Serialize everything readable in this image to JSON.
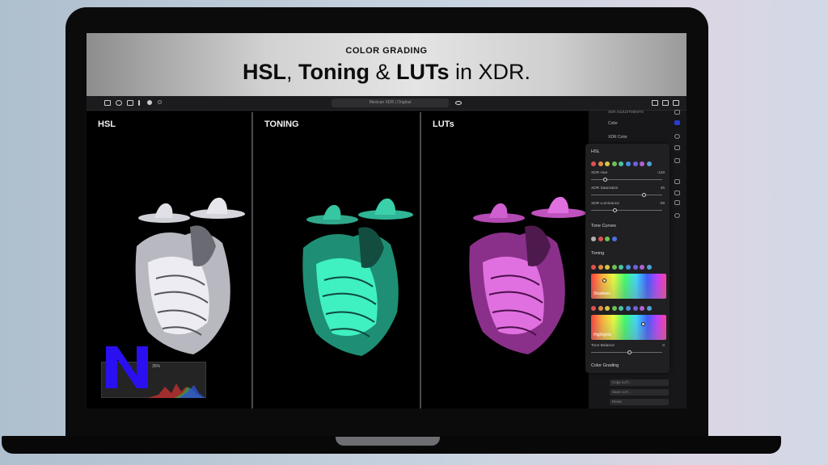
{
  "banner": {
    "kicker": "COLOR GRADING",
    "title_hsl": "HSL",
    "title_sep1": ", ",
    "title_toning": "Toning",
    "title_sep2": " & ",
    "title_luts": "LUTs",
    "title_tail": " in XDR."
  },
  "toolbar": {
    "document_title": "Mexican XDR | Original"
  },
  "panels": [
    {
      "label": "HSL",
      "tint": "#d8d8de"
    },
    {
      "label": "TONING",
      "tint": "#39e0b4"
    },
    {
      "label": "LUTs",
      "tint": "#d25ad2"
    }
  ],
  "histogram": {
    "value": "35%"
  },
  "sidebar": {
    "items": [
      {
        "label": "XDR ADJUSTMENTS"
      },
      {
        "label": "Color"
      },
      {
        "label": "XDR Color"
      }
    ],
    "fields": [
      {
        "label": "Copy LUT..."
      },
      {
        "label": "Save LUT..."
      },
      {
        "label": "Reset"
      }
    ]
  },
  "adjustments": {
    "hsl_heading": "HSL",
    "sliders": [
      {
        "label": "XDR Hue",
        "value": "-129",
        "fraction": 0.2
      },
      {
        "label": "XDR Saturation",
        "value": "45",
        "fraction": 0.75
      },
      {
        "label": "XDR Luminance",
        "value": "-39",
        "fraction": 0.34
      }
    ],
    "tone_curves_heading": "Tone Curves",
    "toning_heading": "Toning",
    "shadows_label": "Shadows",
    "highlights_label": "Highlights",
    "tone_balance_label": "Tone Balance",
    "tone_balance_value": "0",
    "tone_balance_fraction": 0.55,
    "color_grading_heading": "Color Grading",
    "hsl_dot_colors": [
      "#e05050",
      "#e09040",
      "#d8c848",
      "#70c050",
      "#50c0a0",
      "#4a8ce0",
      "#7060d8",
      "#b060d0",
      "#50a0d0"
    ],
    "tone_curve_dot_colors": [
      "#b0b0b0",
      "#e05050",
      "#70c050",
      "#4a70e0"
    ],
    "toning_dot_colors": [
      "#e05050",
      "#e09040",
      "#d8c848",
      "#70c050",
      "#50c0a0",
      "#4a8ce0",
      "#7060d8",
      "#b060d0",
      "#50a0d0"
    ]
  },
  "colors": {
    "accent_blue": "#2a10f0",
    "hsl_figure": "#d8d8de",
    "toning_figure": "#39e0b4",
    "luts_figure": "#d25ad2"
  }
}
